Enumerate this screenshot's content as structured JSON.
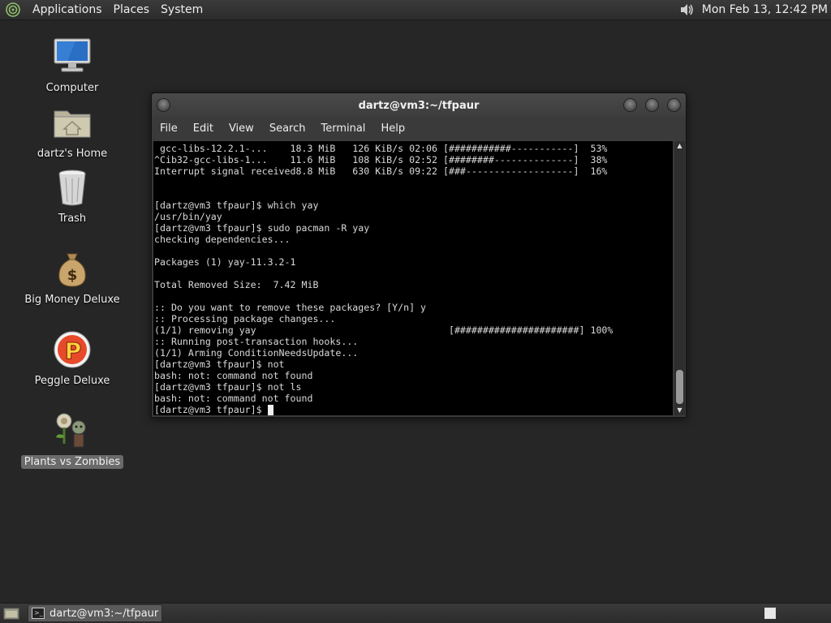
{
  "top_panel": {
    "menus": [
      "Applications",
      "Places",
      "System"
    ],
    "clock": "Mon Feb 13, 12:42 PM"
  },
  "desktop_icons": [
    {
      "label": "Computer",
      "icon": "computer-icon"
    },
    {
      "label": "dartz's Home",
      "icon": "home-folder-icon"
    },
    {
      "label": "Trash",
      "icon": "trash-icon"
    },
    {
      "label": "Big Money Deluxe",
      "icon": "money-bag-icon"
    },
    {
      "label": "Peggle Deluxe",
      "icon": "peggle-icon"
    },
    {
      "label": "Plants vs Zombies",
      "icon": "plants-vs-zombies-icon",
      "selected": true
    }
  ],
  "terminal": {
    "title": "dartz@vm3:~/tfpaur",
    "menu": [
      "File",
      "Edit",
      "View",
      "Search",
      "Terminal",
      "Help"
    ],
    "lines": [
      " gcc-libs-12.2.1-...    18.3 MiB   126 KiB/s 02:06 [###########-----------]  53%",
      "^Cib32-gcc-libs-1...    11.6 MiB   108 KiB/s 02:52 [########--------------]  38%",
      "Interrupt signal received8.8 MiB   630 KiB/s 09:22 [###-------------------]  16%",
      "",
      "",
      "[dartz@vm3 tfpaur]$ which yay",
      "/usr/bin/yay",
      "[dartz@vm3 tfpaur]$ sudo pacman -R yay",
      "checking dependencies...",
      "",
      "Packages (1) yay-11.3.2-1",
      "",
      "Total Removed Size:  7.42 MiB",
      "",
      ":: Do you want to remove these packages? [Y/n] y",
      ":: Processing package changes...",
      "(1/1) removing yay                                  [######################] 100%",
      ":: Running post-transaction hooks...",
      "(1/1) Arming ConditionNeedsUpdate...",
      "[dartz@vm3 tfpaur]$ not",
      "bash: not: command not found",
      "[dartz@vm3 tfpaur]$ not ls",
      "bash: not: command not found"
    ],
    "prompt": "[dartz@vm3 tfpaur]$ "
  },
  "bottom_panel": {
    "task_label": "dartz@vm3:~/tfpaur"
  },
  "colors": {
    "desktop_bg": "#262626",
    "terminal_bg": "#000000",
    "terminal_fg": "#d9d9d9"
  }
}
